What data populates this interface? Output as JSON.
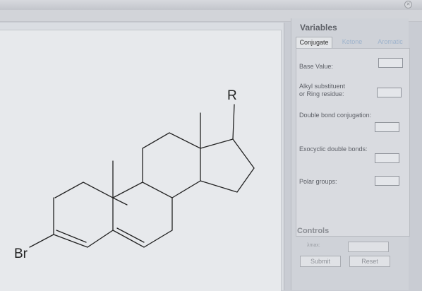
{
  "window": {
    "close_icon": "close-icon"
  },
  "molecule": {
    "atom_labels": {
      "r": "R",
      "br": "Br"
    }
  },
  "panel": {
    "title": "Variables",
    "tabs": [
      {
        "label": "Conjugate",
        "active": true
      },
      {
        "label": "Ketone",
        "active": false
      },
      {
        "label": "Aromatic",
        "active": false
      }
    ],
    "fields": {
      "base_value": "Base Value:",
      "alkyl_line1": "Alkyl substituent",
      "alkyl_line2": "or Ring residue:",
      "double_bond": "Double bond conjugation:",
      "exocyclic": "Exocyclic double bonds:",
      "polar": "Polar groups:"
    },
    "controls": {
      "title": "Controls",
      "lmax_label": "λmax:",
      "submit_label": "Submit",
      "reset_label": "Reset"
    }
  }
}
